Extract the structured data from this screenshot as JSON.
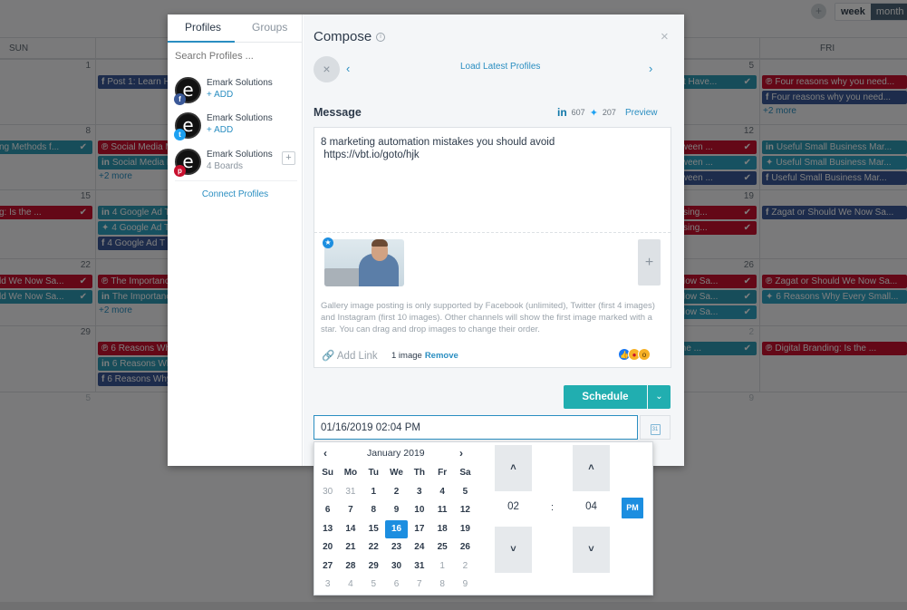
{
  "calendar": {
    "add_button": "+",
    "views": [
      {
        "label": "week",
        "active": false
      },
      {
        "label": "month",
        "active": true
      }
    ],
    "weekday_headers": [
      {
        "label": "SUN",
        "col": 0
      },
      {
        "label": "FRI",
        "col": 5
      }
    ],
    "day_numbers": [
      {
        "label": "1",
        "col": 0,
        "row": 0,
        "muted": false
      },
      {
        "label": "5",
        "col": 4,
        "row": 0,
        "muted": false
      },
      {
        "label": "8",
        "col": 0,
        "row": 1,
        "muted": false
      },
      {
        "label": "12",
        "col": 4,
        "row": 1,
        "muted": false
      },
      {
        "label": "15",
        "col": 0,
        "row": 2,
        "muted": false
      },
      {
        "label": "19",
        "col": 4,
        "row": 2,
        "muted": false
      },
      {
        "label": "22",
        "col": 0,
        "row": 3,
        "muted": false
      },
      {
        "label": "26",
        "col": 4,
        "row": 3,
        "muted": false
      },
      {
        "label": "29",
        "col": 0,
        "row": 4,
        "muted": false
      },
      {
        "label": "2",
        "col": 4,
        "row": 4,
        "muted": true
      },
      {
        "label": "5",
        "col": 0,
        "row": 5,
        "muted": true
      },
      {
        "label": "9",
        "col": 4,
        "row": 5,
        "muted": true
      }
    ],
    "events": [
      {
        "col": 1,
        "row": 0,
        "slot": 0,
        "net": "fb",
        "glyph": "f",
        "title": "Post 1: Learn H",
        "check": false
      },
      {
        "col": 4,
        "row": 0,
        "slot": 0,
        "net": "li",
        "glyph": "",
        "title": "st Have...",
        "check": true
      },
      {
        "col": 5,
        "row": 0,
        "slot": 0,
        "net": "pin",
        "glyph": "℗",
        "title": "Four reasons why you need...",
        "check": false
      },
      {
        "col": 5,
        "row": 0,
        "slot": 1,
        "net": "fb",
        "glyph": "f",
        "title": "Four reasons why you need...",
        "check": false
      },
      {
        "col": 0,
        "row": 1,
        "slot": 0,
        "net": "li",
        "glyph": "",
        "title": "ng Methods f...",
        "check": true
      },
      {
        "col": 1,
        "row": 1,
        "slot": 0,
        "net": "pin",
        "glyph": "℗",
        "title": "Social Media M",
        "check": false
      },
      {
        "col": 1,
        "row": 1,
        "slot": 1,
        "net": "li",
        "glyph": "in",
        "title": "Social Media M",
        "check": false
      },
      {
        "col": 4,
        "row": 1,
        "slot": 0,
        "net": "pin",
        "glyph": "",
        "title": "tween ...",
        "check": true
      },
      {
        "col": 4,
        "row": 1,
        "slot": 1,
        "net": "tw",
        "glyph": "",
        "title": "tween ...",
        "check": true
      },
      {
        "col": 4,
        "row": 1,
        "slot": 2,
        "net": "fb",
        "glyph": "",
        "title": "tween ...",
        "check": true
      },
      {
        "col": 5,
        "row": 1,
        "slot": 0,
        "net": "li",
        "glyph": "in",
        "title": "Useful Small Business Mar...",
        "check": false
      },
      {
        "col": 5,
        "row": 1,
        "slot": 1,
        "net": "tw",
        "glyph": "✦",
        "title": "Useful Small Business Mar...",
        "check": false
      },
      {
        "col": 5,
        "row": 1,
        "slot": 2,
        "net": "fb",
        "glyph": "f",
        "title": "Useful Small Business Mar...",
        "check": false
      },
      {
        "col": 0,
        "row": 2,
        "slot": 0,
        "net": "pin",
        "glyph": "",
        "title": "g: Is the ...",
        "check": true
      },
      {
        "col": 1,
        "row": 2,
        "slot": 0,
        "net": "li",
        "glyph": "in",
        "title": "4 Google Ad T",
        "check": false
      },
      {
        "col": 1,
        "row": 2,
        "slot": 1,
        "net": "tw",
        "glyph": "✦",
        "title": "4 Google Ad T",
        "check": false
      },
      {
        "col": 1,
        "row": 2,
        "slot": 2,
        "net": "fb",
        "glyph": "f",
        "title": "4 Google Ad T",
        "check": false
      },
      {
        "col": 4,
        "row": 2,
        "slot": 0,
        "net": "pin",
        "glyph": "",
        "title": "tising...",
        "check": true
      },
      {
        "col": 4,
        "row": 2,
        "slot": 1,
        "net": "pin",
        "glyph": "",
        "title": "tising...",
        "check": true
      },
      {
        "col": 5,
        "row": 2,
        "slot": 0,
        "net": "fb",
        "glyph": "f",
        "title": "Zagat or Should We Now Sa...",
        "check": false
      },
      {
        "col": 0,
        "row": 3,
        "slot": 0,
        "net": "pin",
        "glyph": "",
        "title": "ld We Now Sa...",
        "check": true
      },
      {
        "col": 0,
        "row": 3,
        "slot": 1,
        "net": "li",
        "glyph": "",
        "title": "ld We Now Sa...",
        "check": true
      },
      {
        "col": 1,
        "row": 3,
        "slot": 0,
        "net": "pin",
        "glyph": "℗",
        "title": "The Importanc",
        "check": false
      },
      {
        "col": 1,
        "row": 3,
        "slot": 1,
        "net": "li",
        "glyph": "in",
        "title": "The Importanc",
        "check": false
      },
      {
        "col": 4,
        "row": 3,
        "slot": 0,
        "net": "pin",
        "glyph": "",
        "title": "Now Sa...",
        "check": true
      },
      {
        "col": 4,
        "row": 3,
        "slot": 1,
        "net": "li",
        "glyph": "",
        "title": "Now Sa...",
        "check": true
      },
      {
        "col": 4,
        "row": 3,
        "slot": 2,
        "net": "tw",
        "glyph": "",
        "title": "Now Sa...",
        "check": true
      },
      {
        "col": 5,
        "row": 3,
        "slot": 0,
        "net": "pin",
        "glyph": "℗",
        "title": "Zagat or Should We Now Sa...",
        "check": false
      },
      {
        "col": 5,
        "row": 3,
        "slot": 1,
        "net": "tw",
        "glyph": "✦",
        "title": "6 Reasons Why Every Small...",
        "check": false
      },
      {
        "col": 1,
        "row": 4,
        "slot": 0,
        "net": "pin",
        "glyph": "℗",
        "title": "6 Reasons Why",
        "check": false
      },
      {
        "col": 1,
        "row": 4,
        "slot": 1,
        "net": "li",
        "glyph": "in",
        "title": "6 Reasons Why",
        "check": false
      },
      {
        "col": 1,
        "row": 4,
        "slot": 2,
        "net": "fb",
        "glyph": "f",
        "title": "6 Reasons Why",
        "check": false
      },
      {
        "col": 4,
        "row": 4,
        "slot": 0,
        "net": "li",
        "glyph": "",
        "title": "the ...",
        "check": true
      },
      {
        "col": 5,
        "row": 4,
        "slot": 0,
        "net": "pin",
        "glyph": "℗",
        "title": "Digital Branding: Is the ...",
        "check": false
      }
    ],
    "more_links": [
      {
        "col": 5,
        "row": 0,
        "slot": 2,
        "label": "+2 more"
      },
      {
        "col": 1,
        "row": 1,
        "slot": 2,
        "label": "+2 more"
      },
      {
        "col": 1,
        "row": 3,
        "slot": 2,
        "label": "+2 more"
      }
    ],
    "colors": {
      "pinterest": "#c8102e",
      "linkedin": "#2f9ab4",
      "twitter": "#2ea3c2",
      "facebook": "#3b5998"
    }
  },
  "profiles_panel": {
    "tabs": [
      {
        "label": "Profiles",
        "active": true
      },
      {
        "label": "Groups",
        "active": false
      }
    ],
    "search_placeholder": "Search Profiles ...",
    "profiles": [
      {
        "name": "Emark Solutions",
        "sub": "+ ADD",
        "network": "facebook",
        "badge": "f",
        "has_plus": false
      },
      {
        "name": "Emark Solutions",
        "sub": "+ ADD",
        "network": "twitter",
        "badge": "t",
        "has_plus": false
      },
      {
        "name": "Emark Solutions",
        "sub": "4 Boards",
        "network": "pinterest",
        "badge": "p",
        "has_plus": true
      }
    ],
    "avatar_letter": "e",
    "connect_label": "Connect Profiles"
  },
  "compose": {
    "title": "Compose",
    "info_icon": "i",
    "close_icon": "×",
    "clear_icon": "×",
    "prev_icon": "‹",
    "next_icon": "›",
    "load_latest_label": "Load Latest Profiles",
    "message_label": "Message",
    "linkedin_count": "607",
    "twitter_count": "207",
    "preview_label": "Preview",
    "message_text": "8 marketing automation mistakes you should avoid\n https://vbt.io/goto/hjk",
    "gallery_note": "Gallery image posting is only supported by Facebook (unlimited), Twitter (first 4 images) and Instagram (first 10 images). Other channels will show the first image marked with a star. You can drag and drop images to change their order.",
    "add_link_label": "Add Link",
    "image_count_label": "1 image",
    "remove_label": "Remove",
    "add_image_icon": "+",
    "schedule_label": "Schedule",
    "schedule_caret": "⌄",
    "datetime_value": "01/16/2019 02:04 PM",
    "calendar_button_text": "31"
  },
  "datepicker": {
    "month_label": "January 2019",
    "prev_icon": "‹",
    "next_icon": "›",
    "weekday_headers": [
      "Su",
      "Mo",
      "Tu",
      "We",
      "Th",
      "Fr",
      "Sa"
    ],
    "weeks": [
      [
        {
          "d": "30",
          "m": true
        },
        {
          "d": "31",
          "m": true
        },
        {
          "d": "1"
        },
        {
          "d": "2"
        },
        {
          "d": "3"
        },
        {
          "d": "4"
        },
        {
          "d": "5"
        }
      ],
      [
        {
          "d": "6"
        },
        {
          "d": "7"
        },
        {
          "d": "8"
        },
        {
          "d": "9"
        },
        {
          "d": "10"
        },
        {
          "d": "11"
        },
        {
          "d": "12"
        }
      ],
      [
        {
          "d": "13"
        },
        {
          "d": "14"
        },
        {
          "d": "15"
        },
        {
          "d": "16",
          "s": true
        },
        {
          "d": "17"
        },
        {
          "d": "18"
        },
        {
          "d": "19"
        }
      ],
      [
        {
          "d": "20"
        },
        {
          "d": "21"
        },
        {
          "d": "22"
        },
        {
          "d": "23"
        },
        {
          "d": "24"
        },
        {
          "d": "25"
        },
        {
          "d": "26"
        }
      ],
      [
        {
          "d": "27"
        },
        {
          "d": "28"
        },
        {
          "d": "29"
        },
        {
          "d": "30"
        },
        {
          "d": "31"
        },
        {
          "d": "1",
          "m": true
        },
        {
          "d": "2",
          "m": true
        }
      ],
      [
        {
          "d": "3",
          "m": true
        },
        {
          "d": "4",
          "m": true
        },
        {
          "d": "5",
          "m": true
        },
        {
          "d": "6",
          "m": true
        },
        {
          "d": "7",
          "m": true
        },
        {
          "d": "8",
          "m": true
        },
        {
          "d": "9",
          "m": true
        }
      ]
    ],
    "selected_day": "16",
    "hour": "02",
    "minute": "04",
    "separator": ":",
    "meridiem": "PM",
    "up_icon": "˄",
    "down_icon": "˅",
    "accent_color": "#1c8ee0"
  }
}
